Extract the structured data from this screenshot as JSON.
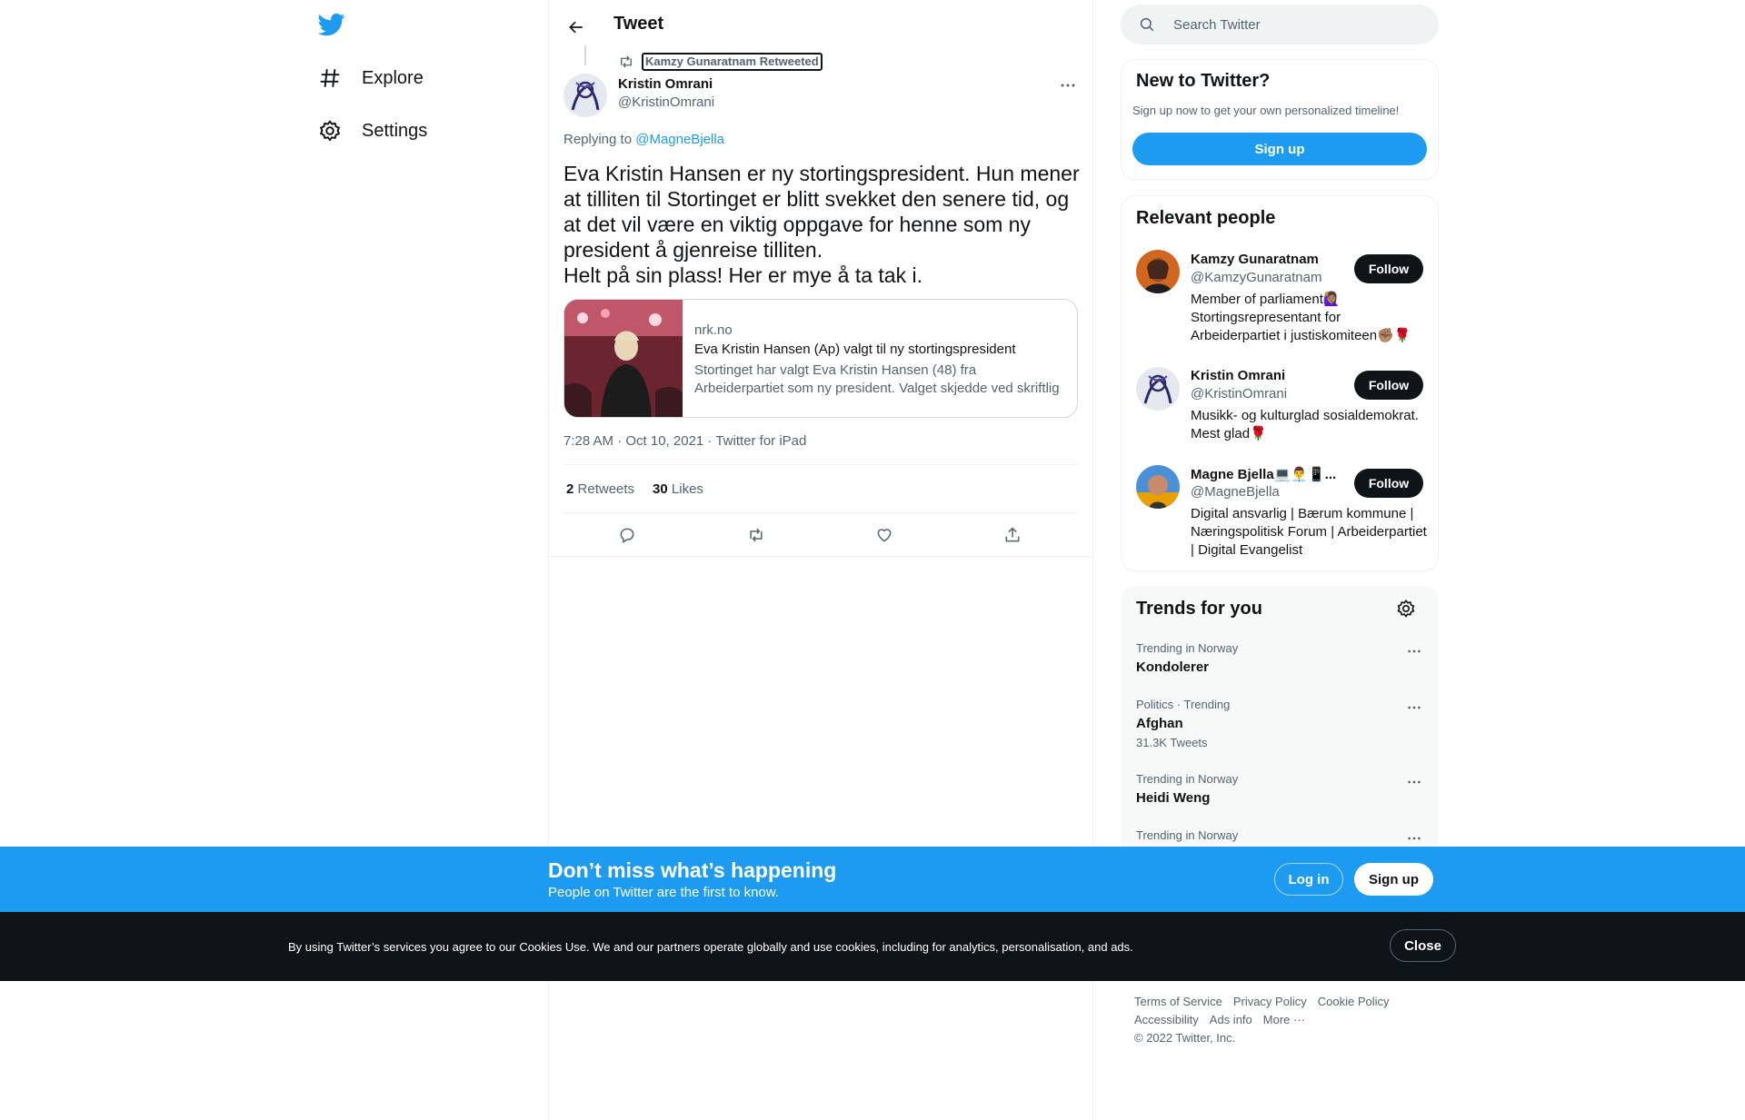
{
  "nav": {
    "explore_label": "Explore",
    "settings_label": "Settings"
  },
  "header": {
    "title": "Tweet"
  },
  "tweet": {
    "retweet_context": "Kamzy Gunaratnam Retweeted",
    "author_name": "Kristin Omrani",
    "author_handle": "@KristinOmrani",
    "replying_prefix": "Replying to ",
    "replying_to": "@MagneBjella",
    "text": "Eva Kristin Hansen er ny stortingspresident. Hun mener at tilliten til Stortinget er blitt svekket den senere tid, og at det vil være en viktig oppgave for henne som ny president å gjenreise tilliten.\nHelt på sin plass! Her er mye å ta tak i.",
    "card": {
      "domain": "nrk.no",
      "title": "Eva Kristin Hansen (Ap) valgt til ny stortingspresident",
      "description": "Stortinget har valgt Eva Kristin Hansen (48) fra Arbeiderpartiet som ny president. Valget skjedde ved skriftlig avstemning."
    },
    "timestamp": "7:28 AM · Oct 10, 2021 · Twitter for iPad",
    "retweets_count": "2",
    "retweets_label": "Retweets",
    "likes_count": "30",
    "likes_label": "Likes"
  },
  "search": {
    "placeholder": "Search Twitter"
  },
  "new_to_twitter": {
    "title": "New to Twitter?",
    "subtitle": "Sign up now to get your own personalized timeline!",
    "signup_label": "Sign up"
  },
  "relevant_people": {
    "title": "Relevant people",
    "people": [
      {
        "name": "Kamzy Gunaratnam",
        "handle": "@KamzyGunaratnam",
        "bio": "Member of parliament🙋🏽‍♀️ Stortingsrepresentant for Arbeiderpartiet i justiskomiteen✊🏽🌹",
        "follow_label": "Follow"
      },
      {
        "name": "Kristin Omrani",
        "handle": "@KristinOmrani",
        "bio": "Musikk- og kulturglad sosialdemokrat. Mest glad🌹",
        "follow_label": "Follow"
      },
      {
        "name": "Magne Bjella💻👨‍💼📱...",
        "handle": "@MagneBjella",
        "bio": "Digital ansvarlig | Bærum kommune | Næringspolitisk Forum | Arbeiderpartiet | Digital Evangelist",
        "follow_label": "Follow"
      }
    ]
  },
  "trends": {
    "title": "Trends for you",
    "items": [
      {
        "meta": "Trending in Norway",
        "name": "Kondolerer",
        "count": ""
      },
      {
        "meta": "Politics · Trending",
        "name": "Afghan",
        "count": "31.3K Tweets"
      },
      {
        "meta": "Trending in Norway",
        "name": "Heidi Weng",
        "count": ""
      },
      {
        "meta": "Trending in Norway",
        "name": "",
        "count": ""
      }
    ]
  },
  "footer": {
    "links": [
      "Terms of Service",
      "Privacy Policy",
      "Cookie Policy",
      "Accessibility",
      "Ads info",
      "More ···"
    ],
    "copyright": "© 2022 Twitter, Inc."
  },
  "banner": {
    "title": "Don’t miss what’s happening",
    "subtitle": "People on Twitter are the first to know.",
    "login_label": "Log in",
    "signup_label": "Sign up"
  },
  "cookie": {
    "text": "By using Twitter’s services you agree to our Cookies Use. We and our partners operate globally and use cookies, including for analytics, personalisation, and ads.",
    "close_label": "Close"
  },
  "colors": {
    "brand": "#1d9bf0",
    "text": "#0f1419",
    "secondary": "#536471"
  }
}
